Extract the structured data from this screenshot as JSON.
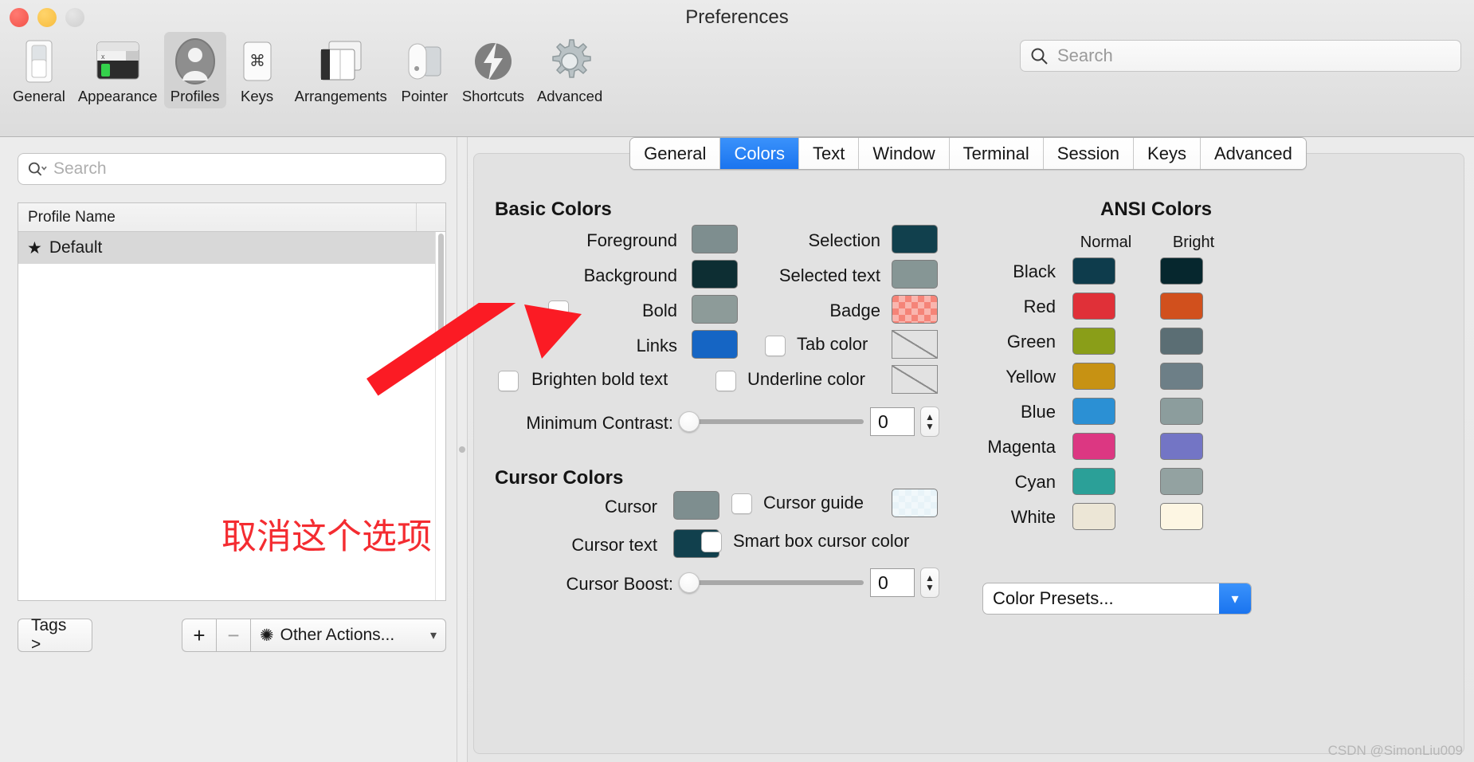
{
  "window": {
    "title": "Preferences",
    "traffic_lights": [
      "close-button",
      "minimize-button",
      "zoom-button"
    ]
  },
  "toolbar": {
    "items": [
      {
        "label": "General",
        "icon": "general-switch-icon",
        "active": false
      },
      {
        "label": "Appearance",
        "icon": "appearance-window-icon",
        "active": false
      },
      {
        "label": "Profiles",
        "icon": "profiles-person-icon",
        "active": true
      },
      {
        "label": "Keys",
        "icon": "keys-command-icon",
        "active": false
      },
      {
        "label": "Arrangements",
        "icon": "arrangements-windows-icon",
        "active": false
      },
      {
        "label": "Pointer",
        "icon": "pointer-mouse-icon",
        "active": false
      },
      {
        "label": "Shortcuts",
        "icon": "shortcuts-bolt-icon",
        "active": false
      },
      {
        "label": "Advanced",
        "icon": "advanced-gear-icon",
        "active": false
      }
    ],
    "search_placeholder": "Search"
  },
  "sidebar": {
    "search_placeholder": "Search",
    "search_icon": "search-dropdown-icon",
    "table": {
      "column_header": "Profile Name",
      "rows": [
        {
          "name": "Default",
          "is_default": true,
          "selected": true,
          "star": "★"
        }
      ]
    },
    "tags_button": "Tags >",
    "add_button": "+",
    "remove_button": "−",
    "other_actions": "Other Actions...",
    "other_actions_icon": "gear-icon",
    "other_actions_caret": "⌄"
  },
  "tabs": [
    {
      "label": "General",
      "active": false
    },
    {
      "label": "Colors",
      "active": true
    },
    {
      "label": "Text",
      "active": false
    },
    {
      "label": "Window",
      "active": false
    },
    {
      "label": "Terminal",
      "active": false
    },
    {
      "label": "Session",
      "active": false
    },
    {
      "label": "Keys",
      "active": false
    },
    {
      "label": "Advanced",
      "active": false
    }
  ],
  "colors_panel": {
    "basic_colors": {
      "title": "Basic Colors",
      "left": [
        {
          "label": "Foreground",
          "color": "#7e8e8f",
          "checkbox": null
        },
        {
          "label": "Background",
          "color": "#0d2e33",
          "checkbox": null
        },
        {
          "label": "Bold",
          "color": "#8d9b99",
          "checkbox": false
        },
        {
          "label": "Links",
          "color": "#1565c4",
          "checkbox": null
        }
      ],
      "brighten_bold_text": {
        "label": "Brighten bold text",
        "checked": false
      },
      "right": [
        {
          "label": "Selection",
          "color": "#11404d",
          "checkbox": null,
          "swatch_type": "solid"
        },
        {
          "label": "Selected text",
          "color": "#869695",
          "checkbox": null,
          "swatch_type": "solid"
        },
        {
          "label": "Badge",
          "color": "#f58478",
          "checkbox": null,
          "swatch_type": "checker"
        },
        {
          "label": "Tab color",
          "color": null,
          "checkbox": false,
          "swatch_type": "none"
        },
        {
          "label": "Underline color",
          "color": null,
          "checkbox": false,
          "swatch_type": "none"
        }
      ],
      "minimum_contrast": {
        "label": "Minimum Contrast:",
        "value": "0",
        "slider_percent": 0
      }
    },
    "cursor_colors": {
      "title": "Cursor Colors",
      "left": [
        {
          "label": "Cursor",
          "color": "#7e8e8f"
        },
        {
          "label": "Cursor text",
          "color": "#11404d"
        }
      ],
      "cursor_guide": {
        "label": "Cursor guide",
        "checked": false,
        "color": "#e8f3f8",
        "swatch_type": "checker"
      },
      "smart_box": {
        "label": "Smart box cursor color",
        "checked": false
      },
      "cursor_boost": {
        "label": "Cursor Boost:",
        "value": "0",
        "slider_percent": 0
      }
    },
    "ansi_colors": {
      "title": "ANSI Colors",
      "col_headers": [
        "Normal",
        "Bright"
      ],
      "rows": [
        {
          "name": "Black",
          "normal": "#0e3c4c",
          "bright": "#06272e"
        },
        {
          "name": "Red",
          "normal": "#e03038",
          "bright": "#d1501d"
        },
        {
          "name": "Green",
          "normal": "#8a9e18",
          "bright": "#5b6e74"
        },
        {
          "name": "Yellow",
          "normal": "#c79213",
          "bright": "#6d7f87"
        },
        {
          "name": "Blue",
          "normal": "#2b90d4",
          "bright": "#8c9d9d"
        },
        {
          "name": "Magenta",
          "normal": "#dc3782",
          "bright": "#7375c5"
        },
        {
          "name": "Cyan",
          "normal": "#2ba098",
          "bright": "#93a2a1"
        },
        {
          "name": "White",
          "normal": "#ece6d6",
          "bright": "#fdf6e3"
        }
      ]
    },
    "color_presets": {
      "label": "Color Presets...",
      "caret": "⌄"
    }
  },
  "annotation": {
    "text": "取消这个选项",
    "color": "#f42c31",
    "arrow": "red-arrow-annotation"
  },
  "watermark": "CSDN @SimonLiu009"
}
